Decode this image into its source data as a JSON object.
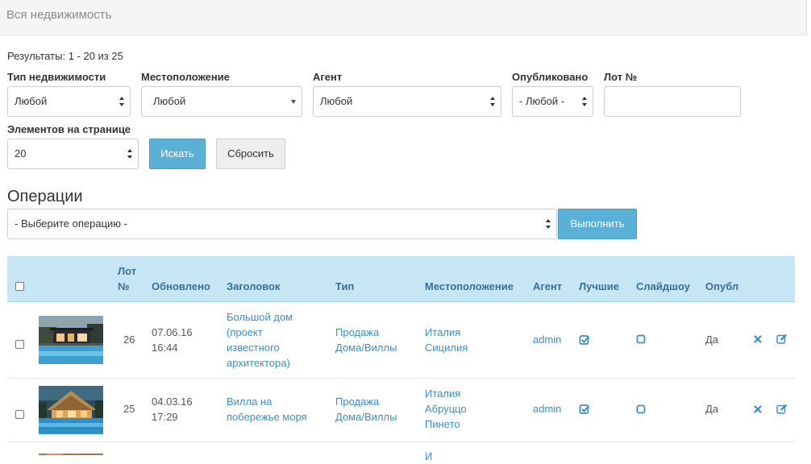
{
  "header": {
    "title": "Вся недвижимость"
  },
  "results_text": "Результаты: 1 - 20 из 25",
  "filters": {
    "type": {
      "label": "Тип недвижимости",
      "value": "Любой"
    },
    "location": {
      "label": "Местоположение",
      "value": "Любой"
    },
    "agent": {
      "label": "Агент",
      "value": "Любой"
    },
    "published": {
      "label": "Опубликовано",
      "value": "- Любой -"
    },
    "lot": {
      "label": "Лот №",
      "value": ""
    },
    "per_page": {
      "label": "Элементов на странице",
      "value": "20"
    },
    "search_label": "Искать",
    "reset_label": "Сбросить"
  },
  "operations": {
    "title": "Операции",
    "select_value": "- Выберите операцию -",
    "execute_label": "Выполнить"
  },
  "table": {
    "columns": [
      "Лот",
      "№",
      "Обновлено",
      "Заголовок",
      "Тип",
      "Местоположение",
      "Агент",
      "Лучшие",
      "Слайдшоу",
      "Опубл"
    ],
    "rows": [
      {
        "lot": "26",
        "date": "07.06.16",
        "time": "16:44",
        "title_lines": [
          "Большой дом",
          "(проект",
          "известного",
          "архитектора)"
        ],
        "type_lines": [
          "Продажа",
          "Дома/Виллы"
        ],
        "location_lines": [
          "Италия",
          "Сицилия"
        ],
        "agent": "admin",
        "published": "Да",
        "featured": true,
        "slideshow": false
      },
      {
        "lot": "25",
        "date": "04.03.16",
        "time": "17:29",
        "title_lines": [
          "Вилла на",
          "побережье моря"
        ],
        "type_lines": [
          "Продажа",
          "Дома/Виллы"
        ],
        "location_lines": [
          "Италия",
          "Абруццо",
          "Пинето"
        ],
        "agent": "admin",
        "published": "Да",
        "featured": true,
        "slideshow": false
      }
    ],
    "partial_row": {
      "location_line": "И"
    }
  },
  "colors": {
    "accent": "#5bb0d7",
    "link": "#3a8fc9",
    "table_header_bg": "#c6e6f6",
    "header_bg": "#f5f5f5"
  }
}
